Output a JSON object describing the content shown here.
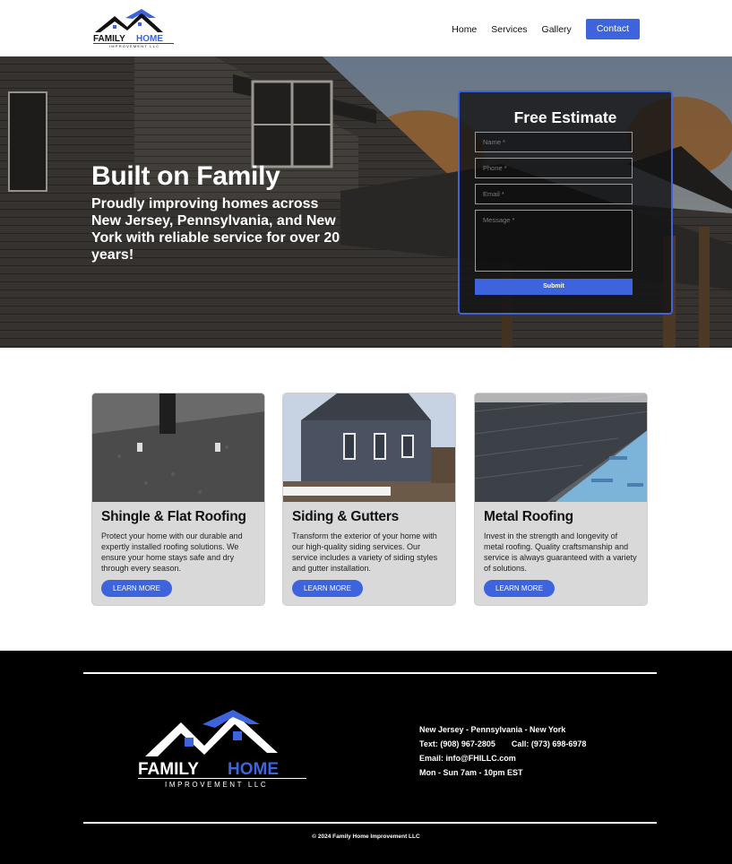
{
  "brand": {
    "logo_name": "FAMILY HOME",
    "logo_family": "FAMILY",
    "logo_home": "HOME",
    "logo_sub": "IMPROVEMENT LLC"
  },
  "nav": {
    "items": [
      "Home",
      "Services",
      "Gallery"
    ],
    "cta": "Contact"
  },
  "hero": {
    "title": "Built on Family",
    "subtitle": "Proudly improving homes across New Jersey, Pennsylvania, and New York with reliable service for over 20 years!"
  },
  "estimate_form": {
    "title": "Free Estimate",
    "name_placeholder": "Name *",
    "phone_placeholder": "Phone *",
    "email_placeholder": "Email *",
    "message_placeholder": "Message *",
    "submit": "Submit"
  },
  "services": [
    {
      "title": "Shingle & Flat Roofing",
      "body": "Protect your home with our durable and expertly installed roofing solutions. We ensure your home stays safe and dry through every season.",
      "button": "LEARN MORE"
    },
    {
      "title": "Siding & Gutters",
      "body": "Transform the exterior of your home with our high-quality siding services. Our service includes a variety of siding styles and gutter installation.",
      "button": "LEARN MORE"
    },
    {
      "title": "Metal Roofing",
      "body": "Invest in the strength and longevity of metal roofing. Quality craftsmanship and service is always guaranteed with a variety of solutions.",
      "button": "LEARN MORE"
    }
  ],
  "footer": {
    "regions": "New Jersey - Pennsylvania - New York",
    "text_line": "Text: (908) 967-2805",
    "call_line": "Call: (973) 698-6978",
    "email_line": "Email: info@FHILLC.com",
    "hours_line": "Mon - Sun 7am - 10pm EST",
    "copyright": "© 2024 Family Home Improvement LLC"
  },
  "colors": {
    "accent": "#3d63dd",
    "footer_bg": "#000000",
    "card_bg": "#d9d9d9"
  }
}
